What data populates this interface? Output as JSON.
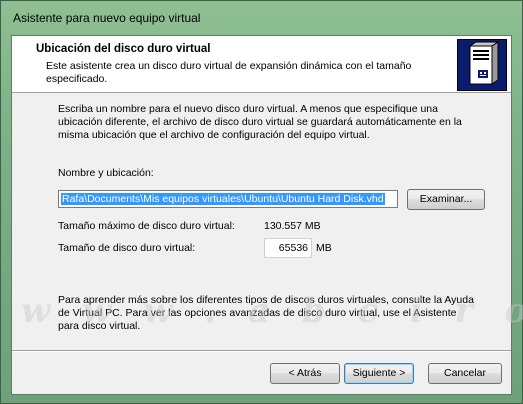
{
  "window": {
    "title": "Asistente para nuevo equipo virtual"
  },
  "header": {
    "title": "Ubicación del disco duro virtual",
    "description": "Este asistente crea un disco duro virtual de expansión dinámica con el tamaño especificado.",
    "icon": "server-icon"
  },
  "main": {
    "intro": "Escriba un nombre para el nuevo disco duro virtual. A menos que especifique una ubicación diferente, el archivo de disco duro virtual se guardará automáticamente en la misma ubicación que el archivo de configuración del equipo virtual.",
    "path_label": "Nombre y ubicación:",
    "path_value": "Rafa\\Documents\\Mis equipos virtuales\\Ubuntu\\Ubuntu Hard Disk.vhd",
    "browse_label": "Examinar...",
    "max_size_label": "Tamaño máximo de disco duro virtual:",
    "max_size_value": "130.557 MB",
    "size_label": "Tamaño de disco duro virtual:",
    "size_value": "65536",
    "size_unit": "MB",
    "help_text": "Para aprender más sobre los diferentes tipos de discos duros virtuales, consulte la Ayuda de Virtual PC. Para ver las opciones avanzadas de disco duro virtual, use el Asistente para disco virtual."
  },
  "footer": {
    "back_label": "< Atrás",
    "next_label": "Siguiente >",
    "cancel_label": "Cancelar"
  },
  "watermark": "w w w . a b c i r o . o r g",
  "colors": {
    "header_icon_bg": "#0b1b6e",
    "selection": "#3399ff"
  }
}
